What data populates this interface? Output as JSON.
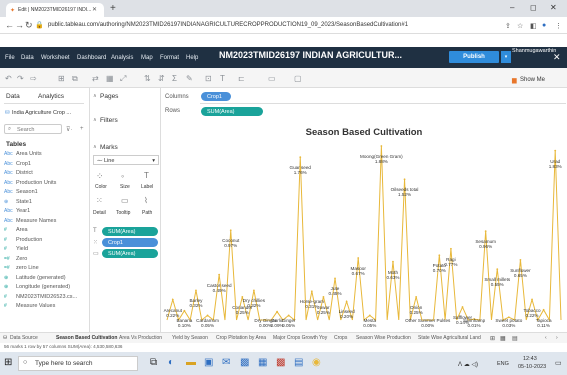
{
  "browser": {
    "tab_title": "Edit | NM2023TMID26197 INDI...",
    "url": "public.tableau.com/authoring/NM2023TMID26197INDIANAGRICULTURECROPPRODUCTION19_09_2023/SeasonBasedCultivation#1"
  },
  "menu": {
    "items": [
      "File",
      "Data",
      "Worksheet",
      "Dashboard",
      "Analysis",
      "Map",
      "Format",
      "Help"
    ],
    "title": "NM2023TMID26197 INDIAN AGRICULTUR...",
    "publish": "Publish",
    "user": "Shanmugawarthin"
  },
  "toolbar": {
    "show_me": "Show Me"
  },
  "data_pane": {
    "tab_data": "Data",
    "tab_analytics": "Analytics",
    "source": "India Agriculture Crop ...",
    "search_placeholder": "Search",
    "tables_header": "Tables",
    "fields": [
      {
        "name": "Area Units",
        "icon": "Abc",
        "color": "#4a90d9"
      },
      {
        "name": "Crop1",
        "icon": "Abc",
        "color": "#4a90d9"
      },
      {
        "name": "District",
        "icon": "Abc",
        "color": "#4a90d9"
      },
      {
        "name": "Production Units",
        "icon": "Abc",
        "color": "#4a90d9"
      },
      {
        "name": "Season1",
        "icon": "Abc",
        "color": "#4a90d9"
      },
      {
        "name": "State1",
        "icon": "globe",
        "color": "#4a90d9"
      },
      {
        "name": "Year1",
        "icon": "Abc",
        "color": "#4a90d9"
      },
      {
        "name": "Measure Names",
        "icon": "Abc",
        "color": "#4a90d9"
      },
      {
        "name": "Area",
        "icon": "#",
        "color": "#1aa39a"
      },
      {
        "name": "Production",
        "icon": "#",
        "color": "#1aa39a"
      },
      {
        "name": "Yield",
        "icon": "#",
        "color": "#1aa39a"
      },
      {
        "name": "Zero",
        "icon": "=#",
        "color": "#1aa39a"
      },
      {
        "name": "zero Line",
        "icon": "=#",
        "color": "#1aa39a"
      },
      {
        "name": "Latitude (generated)",
        "icon": "globe",
        "color": "#1aa39a"
      },
      {
        "name": "Longitude (generated)",
        "icon": "globe",
        "color": "#1aa39a"
      },
      {
        "name": "NM2023TMID26523.cs...",
        "icon": "#",
        "color": "#1aa39a"
      },
      {
        "name": "Measure Values",
        "icon": "#",
        "color": "#1aa39a"
      }
    ]
  },
  "cards": {
    "pages": "Pages",
    "filters": "Filters",
    "marks": "Marks",
    "mark_type": "Line",
    "color": "Color",
    "size": "Size",
    "label": "Label",
    "detail": "Detail",
    "tooltip": "Tooltip",
    "path": "Path",
    "pills": [
      "SUM(Area)",
      "Crop1",
      "SUM(Area)"
    ]
  },
  "shelves": {
    "columns_label": "Columns",
    "rows_label": "Rows",
    "column_pill": "Crop1",
    "row_pill": "SUM(Area)"
  },
  "sheet": {
    "title": "Season Based Cultivation"
  },
  "chart_data": {
    "type": "line",
    "color": "#e8b83a",
    "labels": [
      {
        "name": "Arecanut",
        "pct": "0.22%"
      },
      {
        "name": "Banana",
        "pct": "0.10%"
      },
      {
        "name": "Barley",
        "pct": "0.32%"
      },
      {
        "name": "Cardamom",
        "pct": "0.05%"
      },
      {
        "name": "Castor seed",
        "pct": "0.49%"
      },
      {
        "name": "Coconut",
        "pct": "0.97%"
      },
      {
        "name": "Coriander",
        "pct": "0.25%"
      },
      {
        "name": "Dry chillies",
        "pct": "0.32%"
      },
      {
        "name": "Dry Ginger",
        "pct": "0.00%"
      },
      {
        "name": "Garlic",
        "pct": "0.09%"
      },
      {
        "name": "Ginger",
        "pct": "0.05%"
      },
      {
        "name": "Guar seed",
        "pct": "1.76%"
      },
      {
        "name": "Horse-gram",
        "pct": "0.31%"
      },
      {
        "name": "Jowar",
        "pct": "0.25%"
      },
      {
        "name": "Jute",
        "pct": "0.45%"
      },
      {
        "name": "Linseed",
        "pct": "0.20%"
      },
      {
        "name": "Masoor",
        "pct": "0.67%"
      },
      {
        "name": "Mesta",
        "pct": "0.05%"
      },
      {
        "name": "Moong(Green Gram)",
        "pct": "1.88%"
      },
      {
        "name": "Moth",
        "pct": "0.63%"
      },
      {
        "name": "Oilseeds total",
        "pct": "1.52%"
      },
      {
        "name": "Onion",
        "pct": "0.25%"
      },
      {
        "name": "Other Summer Pulses",
        "pct": "0.00%"
      },
      {
        "name": "Potato",
        "pct": "0.70%"
      },
      {
        "name": "Ragi",
        "pct": "0.77%"
      },
      {
        "name": "Safflower",
        "pct": "0.14%"
      },
      {
        "name": "Sannhamp",
        "pct": "0.01%"
      },
      {
        "name": "Sesamum",
        "pct": "0.96%"
      },
      {
        "name": "Small millets",
        "pct": "0.55%"
      },
      {
        "name": "Sweet potato",
        "pct": "0.03%"
      },
      {
        "name": "Sunflower",
        "pct": "0.65%"
      },
      {
        "name": "Tobacco",
        "pct": "0.22%"
      },
      {
        "name": "Tapioca",
        "pct": "0.11%"
      },
      {
        "name": "Urad",
        "pct": "1.83%"
      }
    ]
  },
  "sheet_tabs": [
    "Data Source",
    "Season Based Cultivation",
    "Area Vs Production",
    "Yield by Season",
    "Crop Plotation by Area",
    "Major Crops Growth Yoy",
    "Crops",
    "Season Wise Production",
    "State Wise Agricultural Land"
  ],
  "status": {
    "text": "56 marks   1 row by 57 columns   SUM(Area): 4,530,580,636"
  },
  "taskbar": {
    "search": "Type here to search",
    "lang": "ENG",
    "time": "12:43",
    "date": "05-10-2023"
  }
}
